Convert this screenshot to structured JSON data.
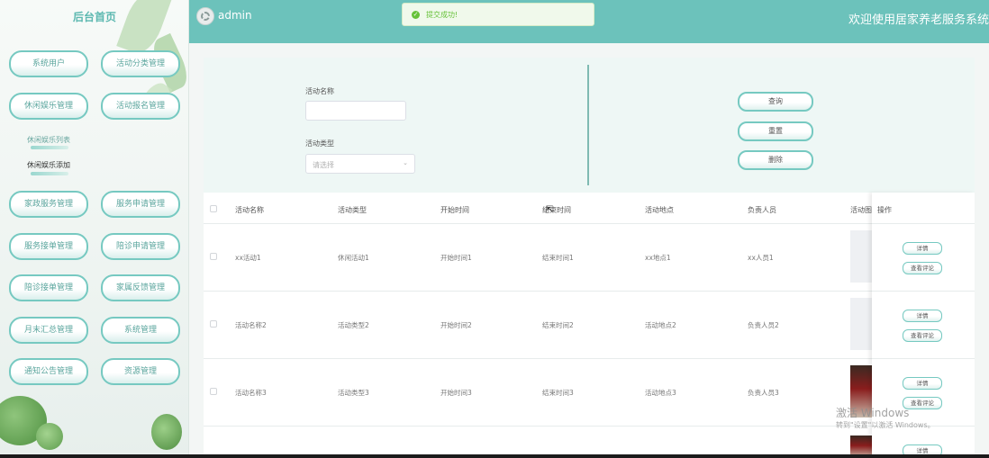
{
  "sidebar": {
    "title": "后台首页",
    "menu": [
      "系统用户",
      "活动分类管理",
      "休闲娱乐管理",
      "活动报名管理",
      "家政服务管理",
      "服务申请管理",
      "服务接单管理",
      "陪诊申请管理",
      "陪诊接单管理",
      "家属反馈管理",
      "月末汇总管理",
      "系统管理",
      "通知公告管理",
      "资源管理"
    ],
    "submenu": [
      "休闲娱乐列表",
      "休闲娱乐添加"
    ]
  },
  "header": {
    "username": "admin",
    "welcome": "欢迎使用居家养老服务系统",
    "toast": "提交成功!"
  },
  "search": {
    "name_label": "活动名称",
    "name_value": "",
    "type_label": "活动类型",
    "type_placeholder": "请选择",
    "buttons": [
      "查询",
      "重置",
      "删除"
    ]
  },
  "table": {
    "headers": [
      "活动名称",
      "活动类型",
      "开始时间",
      "结束时间",
      "活动地点",
      "负责人员",
      "活动图片",
      "操作"
    ],
    "rows": [
      [
        "xx活动1",
        "休闲活动1",
        "开始时间1",
        "结束时间1",
        "xx地点1",
        "xx人员1"
      ],
      [
        "活动名称2",
        "活动类型2",
        "开始时间2",
        "结束时间2",
        "活动地点2",
        "负责人员2"
      ],
      [
        "活动名称3",
        "活动类型3",
        "开始时间3",
        "结束时间3",
        "活动地点3",
        "负责人员3"
      ]
    ],
    "op_detail": "详情",
    "op_review": "查看评论"
  },
  "watermark": {
    "line1": "激活 Windows",
    "line2": "转到\"设置\"以激活 Windows。"
  },
  "colors": {
    "accent": "#6cc2bb",
    "border": "#76c9c1",
    "success": "#67c23a"
  }
}
